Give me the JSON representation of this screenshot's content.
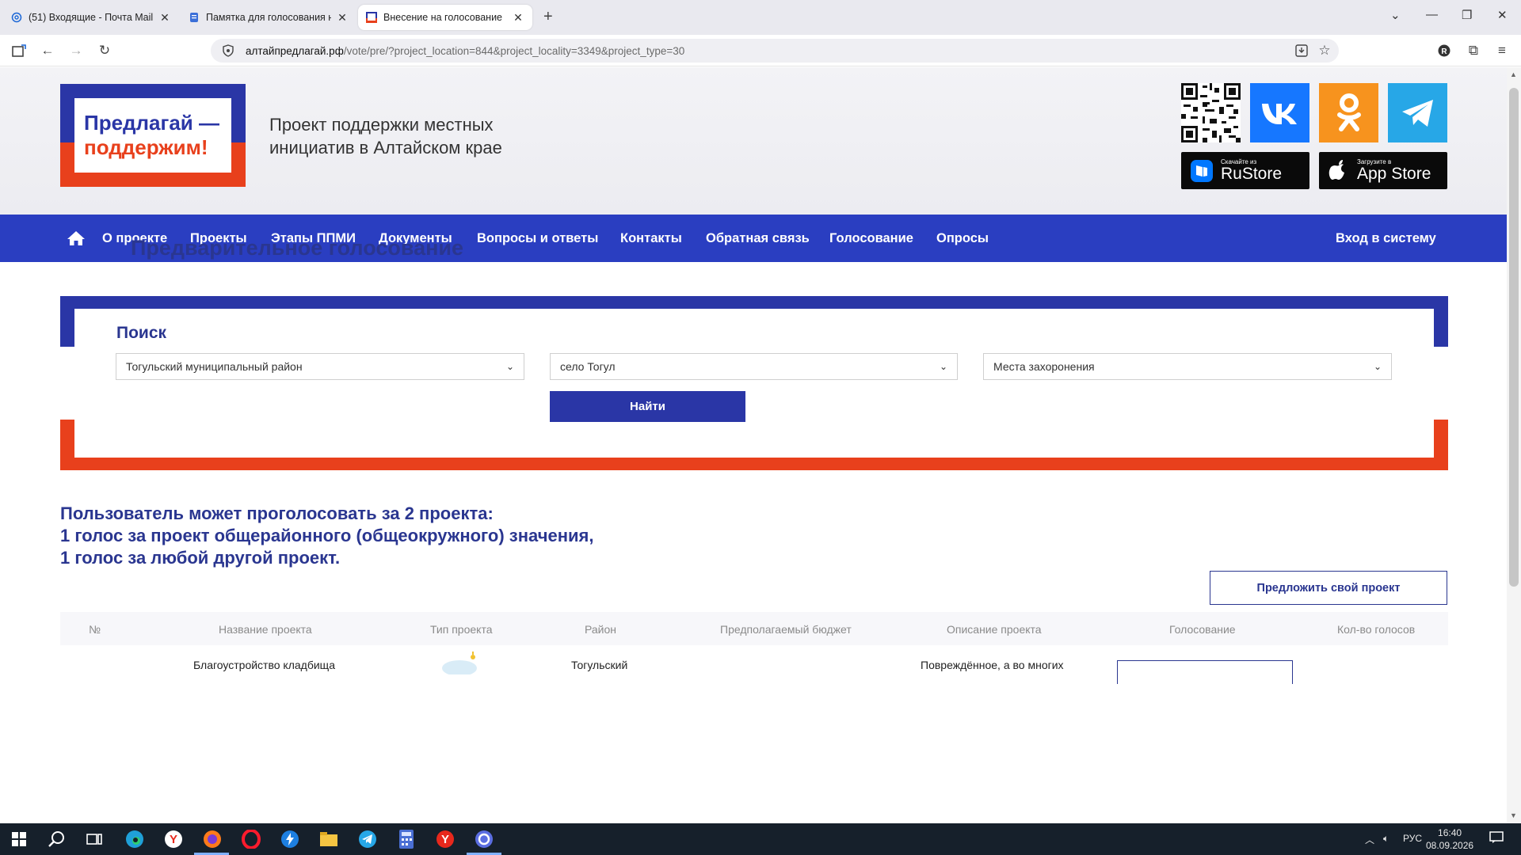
{
  "browser": {
    "tabs": [
      {
        "label": "(51) Входящие - Почта Mail",
        "active": false
      },
      {
        "label": "Памятка для голосования на с",
        "active": false
      },
      {
        "label": "Внесение на голосование",
        "active": true
      }
    ],
    "url_host": "алтайпредлагай.рф",
    "url_path": "/vote/pre/?project_location=844&project_locality=3349&project_type=30"
  },
  "header": {
    "logo_line1": "Предлагай —",
    "logo_line2": "поддержим!",
    "tagline_line1": "Проект поддержки местных",
    "tagline_line2": "инициатив в Алтайском крае",
    "rustore_small": "Скачайте из",
    "rustore_big": "RuStore",
    "appstore_small": "Загрузите в",
    "appstore_big": "App Store"
  },
  "nav": {
    "items": [
      "О проекте",
      "Проекты",
      "Этапы ППМИ",
      "Документы",
      "Вопросы и ответы",
      "Контакты",
      "Обратная связь",
      "Голосование",
      "Опросы"
    ],
    "login": "Вход в систему"
  },
  "page": {
    "title": "Предварительное голосование",
    "search_title": "Поиск",
    "select_district": "Тогульский муниципальный район",
    "select_locality": "село Тогул",
    "select_type": "Места захоронения",
    "find_button": "Найти",
    "notice_line1": "Пользователь может проголосовать за 2 проекта:",
    "notice_line2": "1 голос за проект общерайонного (общеокружного) значения,",
    "notice_line3": "1 голос за любой другой проект.",
    "propose_button": "Предложить свой проект"
  },
  "table": {
    "columns": [
      "№",
      "Название проекта",
      "Тип проекта",
      "Район",
      "Предполагаемый бюджет",
      "Описание проекта",
      "Голосование",
      "Кол-во голосов"
    ],
    "row1": {
      "name": "Благоустройство кладбища",
      "district": "Тогульский",
      "description": "Повреждённое, а во многих"
    }
  },
  "taskbar": {
    "lang": "РУС",
    "time": "16:40",
    "date": "08.09.2026"
  },
  "colors": {
    "brand_blue": "#2a36a6",
    "nav_blue": "#2a3ec1",
    "brand_red": "#e8401c",
    "title_blue": "#2a3690"
  }
}
